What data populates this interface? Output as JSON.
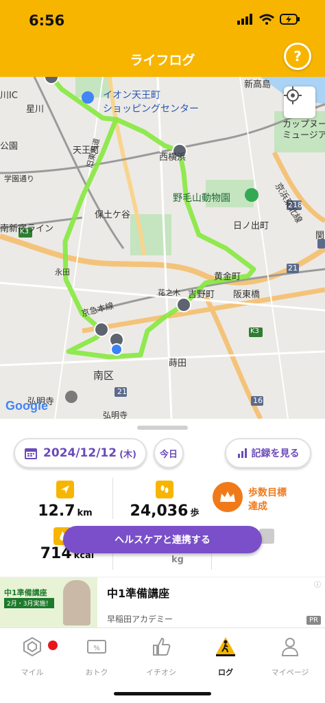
{
  "status_bar": {
    "time": "6:56"
  },
  "header": {
    "title": "ライフログ",
    "help_label": "?"
  },
  "map": {
    "labels": {
      "ic": "川IC",
      "hoshikawa": "星川",
      "aeon": "イオン天王町",
      "aeon2": "ショッピングセンター",
      "shintakashima": "新高島",
      "cupnoodle": "カップヌードル",
      "museum": "ミュージアム",
      "park": "公園",
      "tennocho": "天王町",
      "nishi": "西横浜",
      "keihin": "京浜東北線",
      "gakko": "学園通り",
      "tokaido": "旧東海道",
      "nogeyama": "野毛山動物園",
      "hodogaya": "保土ケ谷",
      "route218": "218",
      "hinodecho": "日ノ出町",
      "shinjuku": "南新宿ライン",
      "seki": "関",
      "k3": "K3",
      "nagata": "永田",
      "koganecho": "黄金町",
      "r21": "21",
      "hantobashi": "阪東橋",
      "keikyu": "京急本線",
      "hananoki": "花之木",
      "yoshinocho": "吉野町",
      "k3b": "K3",
      "maita": "蒔田",
      "minamiku": "南区",
      "r21b": "21",
      "gumyoji": "弘明寺",
      "r16": "16",
      "gumyoji2": "弘明寺"
    },
    "attribution": "Google"
  },
  "controls": {
    "date": "2024/12/12",
    "weekday": "(木)",
    "today_label": "今日",
    "record_label": "記録を見る"
  },
  "stats": {
    "distance": {
      "value": "12.7",
      "unit": "km"
    },
    "steps": {
      "value": "24,036",
      "unit": "歩"
    },
    "goal": {
      "line1": "歩数目標",
      "line2": "達成"
    },
    "calories": {
      "value": "714",
      "unit": "kcal"
    },
    "weight_unit": "kg"
  },
  "health_button": "ヘルスケアと連携する",
  "ad": {
    "title": "中1準備講座",
    "sponsor": "早稲田アカデミー",
    "pr": "PR",
    "thumb_line1": "中1準備講座",
    "thumb_line2": "2月・3月実施！"
  },
  "tabs": [
    {
      "label": "マイル"
    },
    {
      "label": "おトク"
    },
    {
      "label": "イチオシ"
    },
    {
      "label": "ログ"
    },
    {
      "label": "マイページ"
    }
  ],
  "colors": {
    "accent": "#f7b500",
    "purple": "#7a4fc9",
    "route": "#7ee23a",
    "orange": "#f07a1a"
  }
}
